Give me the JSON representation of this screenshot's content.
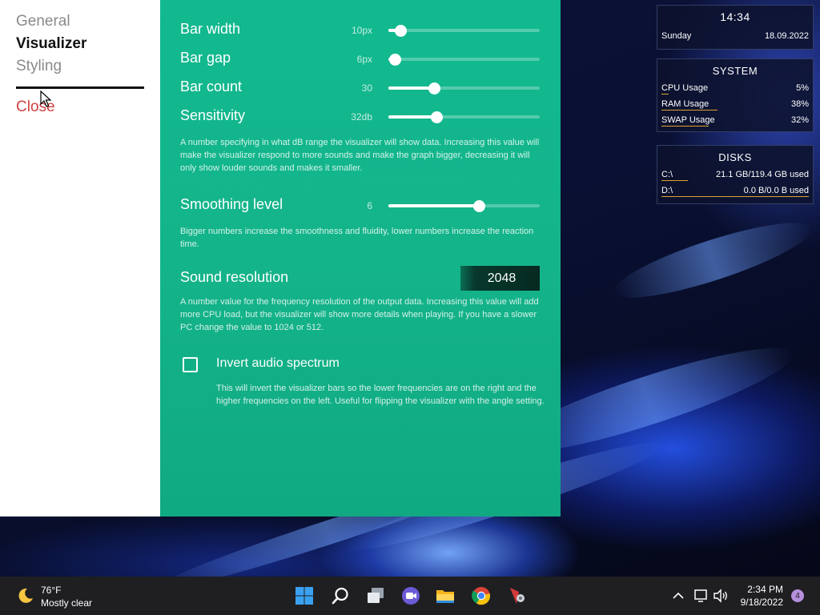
{
  "nav": {
    "items": [
      "General",
      "Visualizer",
      "Styling"
    ],
    "close_label": "Close"
  },
  "visualizer": {
    "bar_width": {
      "label": "Bar width",
      "value": "10px",
      "level": 0.08
    },
    "bar_gap": {
      "label": "Bar gap",
      "value": "6px",
      "level": 0.04
    },
    "bar_count": {
      "label": "Bar count",
      "value": "30",
      "level": 0.3
    },
    "sensitivity": {
      "label": "Sensitivity",
      "value": "32db",
      "level": 0.32,
      "description": "A number specifying in what dB range the visualizer will show data. Increasing this value will make the visualizer respond to more sounds and make the graph bigger, decreasing it will only show louder sounds and makes it smaller."
    },
    "smoothing": {
      "label": "Smoothing level",
      "value": "6",
      "level": 0.6,
      "description": "Bigger numbers increase the smoothness and fluidity, lower numbers increase the reaction time."
    },
    "sound_resolution": {
      "label": "Sound resolution",
      "value": "2048",
      "description": "A number value for the frequency resolution of the output data. Increasing this value will add more CPU load, but the visualizer will show more details when playing. If you have a slower PC change the value to 1024 or 512."
    },
    "invert": {
      "label": "Invert audio spectrum",
      "checked": false,
      "description": "This will invert the visualizer bars so the lower frequencies are on the right and the higher frequencies on the left. Useful for flipping the visualizer with the angle setting."
    }
  },
  "widgets": {
    "clock": {
      "time": "14:34",
      "day": "Sunday",
      "date": "18.09.2022"
    },
    "system": {
      "title": "SYSTEM",
      "rows": [
        {
          "label": "CPU Usage",
          "value": "5%",
          "level": 0.05
        },
        {
          "label": "RAM Usage",
          "value": "38%",
          "level": 0.38
        },
        {
          "label": "SWAP Usage",
          "value": "32%",
          "level": 0.32
        }
      ]
    },
    "disks": {
      "title": "DISKS",
      "rows": [
        {
          "label": "C:\\",
          "value": "21.1 GB/119.4 GB used",
          "level": 0.18
        },
        {
          "label": "D:\\",
          "value": "0.0 B/0.0 B used",
          "level": 1.0
        }
      ]
    }
  },
  "taskbar": {
    "weather_temp": "76°F",
    "weather_desc": "Mostly clear",
    "time": "2:34 PM",
    "date": "9/18/2022",
    "notification_count": "4",
    "icons": [
      "start-icon",
      "search-icon",
      "task-view-icon",
      "chat-icon",
      "file-explorer-icon",
      "chrome-icon",
      "app-icon"
    ]
  },
  "colors": {
    "panel_green": "#12b98f",
    "close_red": "#d04040",
    "widget_bar": "#e0a030",
    "taskbar_bg": "#1f1f22",
    "notification_badge": "#b58fdc"
  }
}
